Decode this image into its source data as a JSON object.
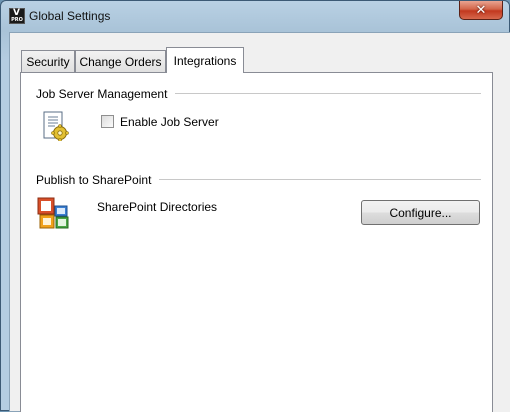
{
  "window": {
    "title": "Global Settings",
    "close_glyph": "✕",
    "app_icon": {
      "name": "app-logo-icon",
      "top_text": "V",
      "bottom_text": "PRO"
    }
  },
  "tabs": [
    {
      "label": "Security",
      "active": false
    },
    {
      "label": "Change Orders",
      "active": false
    },
    {
      "label": "Integrations",
      "active": true
    }
  ],
  "integrations": {
    "job_server": {
      "group_title": "Job Server Management",
      "icon": "job-server-document-gear-icon",
      "checkbox_label": "Enable Job Server",
      "checked": false
    },
    "sharepoint": {
      "group_title": "Publish to SharePoint",
      "icon": "microsoft-office-sharepoint-icon",
      "directories_label": "SharePoint Directories",
      "configure_label": "Configure..."
    }
  },
  "colors": {
    "close_button": "#c2381f",
    "frame": "#a9c3d8",
    "panel": "#ffffff"
  }
}
